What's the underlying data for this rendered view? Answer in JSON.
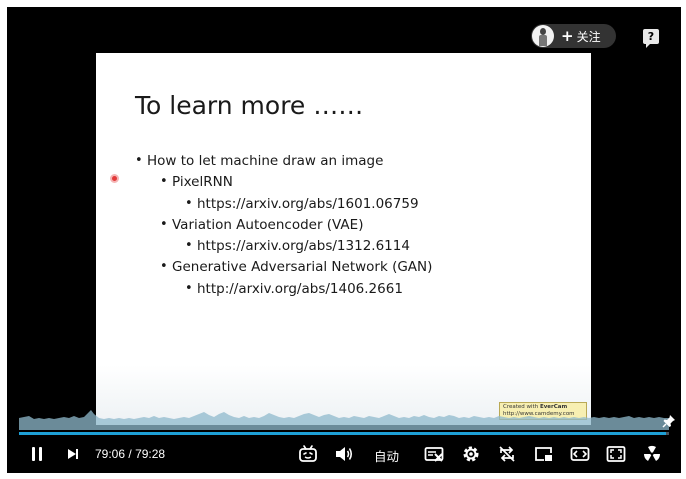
{
  "header": {
    "follow_label": "关注",
    "follow_plus": "+",
    "help_glyph": "?"
  },
  "slide": {
    "title": "To learn more ……",
    "bullets": [
      {
        "level": 1,
        "text": "How to let machine draw an image"
      },
      {
        "level": 2,
        "text": "PixelRNN"
      },
      {
        "level": 3,
        "text": "https://arxiv.org/abs/1601.06759"
      },
      {
        "level": 2,
        "text": "Variation Autoencoder (VAE)"
      },
      {
        "level": 3,
        "text": "https://arxiv.org/abs/1312.6114"
      },
      {
        "level": 2,
        "text": "Generative Adversarial Network (GAN)"
      },
      {
        "level": 3,
        "text": "http://arxiv.org/abs/1406.2661"
      }
    ],
    "watermark_line1_prefix": "Created with",
    "watermark_brand": "EverCam",
    "watermark_line2": "http://www.camdemy.com"
  },
  "playback": {
    "current_time": "79:06",
    "separator": "/",
    "total_time": "79:28",
    "progress_percent": 99.5,
    "autoplay_label": "自动"
  },
  "colors": {
    "accent": "#1ea0d6",
    "track": "#47535c",
    "waveform": "#9fc7d9",
    "background": "#000000"
  },
  "icons": [
    "play-pause-icon",
    "next-icon",
    "danmaku-icon",
    "volume-icon",
    "danmaku-off-icon",
    "settings-icon",
    "loop-off-icon",
    "pip-icon",
    "widescreen-icon",
    "web-fullscreen-icon",
    "fullscreen-icon",
    "pin-icon"
  ]
}
